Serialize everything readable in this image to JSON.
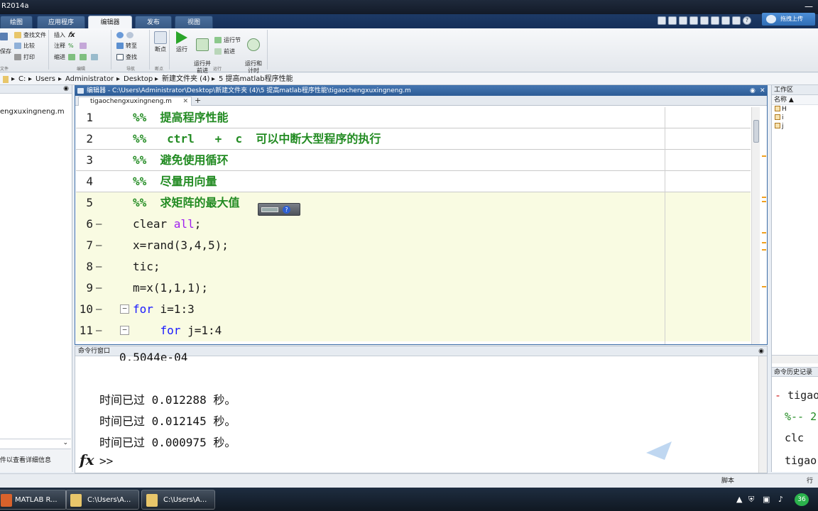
{
  "window": {
    "title": "R2014a"
  },
  "ribbon": {
    "tabs": [
      "绘图",
      "应用程序",
      "编辑器",
      "发布",
      "视图"
    ],
    "active_tab": "编辑器",
    "upload_label": "拖拽上传",
    "file_group": {
      "save": "保存",
      "find_files": "查找文件",
      "compare": "比较",
      "print": "打印",
      "label": "文件"
    },
    "edit_group": {
      "insert": "插入",
      "comment": "注释",
      "indent": "缩进",
      "label": "编辑"
    },
    "nav_group": {
      "goto": "转至",
      "find": "查找",
      "label": "导航"
    },
    "breakpoint_group": {
      "breakpoints": "断点",
      "label": "断点"
    },
    "run_group": {
      "run": "运行",
      "run_advance": "运行并\n前进",
      "run_section": "运行节",
      "advance": "前进",
      "run_time": "运行和\n计时",
      "label": "运行"
    }
  },
  "address": {
    "path": [
      "C:",
      "Users",
      "Administrator",
      "Desktop",
      "新建文件夹 (4)",
      "5  提高matlab程序性能"
    ]
  },
  "left_panel": {
    "file": "engxuxingneng.m",
    "detail": "件以查看详细信息"
  },
  "editor": {
    "title": "编辑器 - C:\\Users\\Administrator\\Desktop\\新建文件夹 (4)\\5  提高matlab程序性能\\tigaochengxuxingneng.m",
    "tab": "tigaochengxuxingneng.m",
    "lines": [
      {
        "n": "1",
        "text": "%%  提高程序性能",
        "type": "comment"
      },
      {
        "n": "2",
        "text": "%%   ctrl   +  c  可以中断大型程序的执行",
        "type": "comment"
      },
      {
        "n": "3",
        "text": "%%  避免使用循环",
        "type": "comment"
      },
      {
        "n": "4",
        "text": "%%  尽量用向量",
        "type": "comment"
      },
      {
        "n": "5",
        "text": "%%  求矩阵的最大值",
        "type": "comment"
      },
      {
        "n": "6",
        "pre": "clear ",
        "str": "all",
        "post": ";"
      },
      {
        "n": "7",
        "text": "x=rand(3,4,5);"
      },
      {
        "n": "8",
        "text": "tic;"
      },
      {
        "n": "9",
        "text": "m=x(1,1,1);"
      },
      {
        "n": "10",
        "kw": "for",
        "post": " i=1:3"
      },
      {
        "n": "11",
        "pre": "    ",
        "kw": "for",
        "post": " j=1:4"
      }
    ]
  },
  "command_window": {
    "title": "命令行窗口",
    "lines": [
      "0.5044e-04",
      "时间已过 0.012288 秒。",
      "时间已过 0.012145 秒。",
      "时间已过 0.000975 秒。"
    ],
    "prompt": ">>"
  },
  "workspace": {
    "title": "工作区",
    "column": "名称 ▲",
    "vars": [
      "H",
      "i",
      "j"
    ]
  },
  "history": {
    "title": "命令历史记录",
    "lines": [
      "tigao",
      "%-- 2",
      "clc",
      "tigao"
    ]
  },
  "status": {
    "script": "脚本",
    "row": "行"
  },
  "taskbar": {
    "items": [
      "MATLAB R...",
      "C:\\Users\\A...",
      "C:\\Users\\A..."
    ],
    "badge": "36"
  }
}
